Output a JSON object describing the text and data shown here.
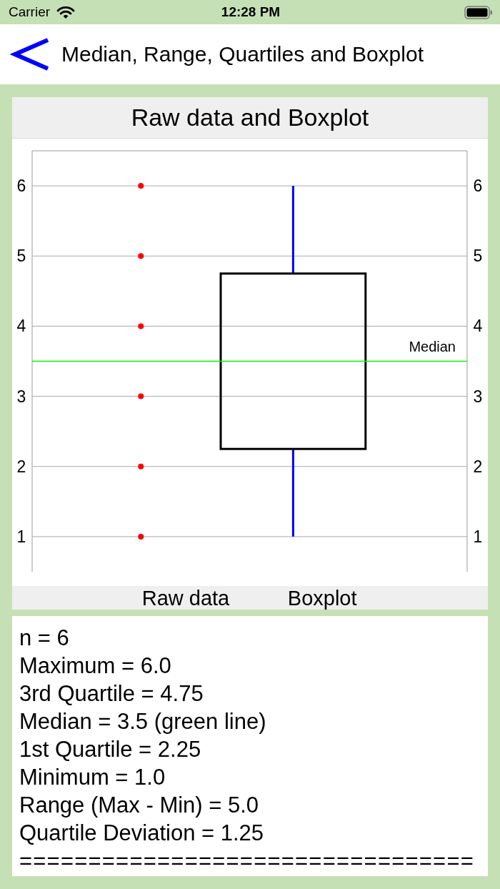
{
  "status_bar": {
    "carrier": "Carrier",
    "time": "12:28 PM"
  },
  "nav_bar": {
    "title": "Median, Range, Quartiles and Boxplot"
  },
  "chart_panel": {
    "chart_data": {
      "type": "scatter",
      "title": "Raw data and Boxplot",
      "categories": [
        "Raw data",
        "Boxplot"
      ],
      "series": [
        {
          "color": "#ff0000",
          "values": [
            1,
            null
          ]
        },
        {
          "color": "#ff0000",
          "values": [
            2,
            null
          ]
        },
        {
          "color": "#ff0000",
          "values": [
            3,
            null
          ]
        },
        {
          "color": "#ff0000",
          "values": [
            4,
            null
          ]
        },
        {
          "color": "#ff0000",
          "values": [
            5,
            null
          ]
        },
        {
          "color": "#ff0000",
          "values": [
            6,
            null
          ]
        }
      ],
      "ylim": [
        0.5,
        6.5
      ],
      "yticks": [
        1,
        2,
        3,
        4,
        5,
        6
      ],
      "grid": true,
      "ref_lines": [
        {
          "axis": "y",
          "value": 3.5,
          "label": "Median",
          "color": "#00ff00"
        }
      ]
    },
    "left_axis_labels": [
      "6",
      "5",
      "4",
      "3",
      "2",
      "1"
    ],
    "right_axis_labels": [
      "6",
      "5",
      "4",
      "3",
      "2",
      "1"
    ]
  },
  "results": {
    "lines": [
      "n = 6",
      "Maximum = 6.0",
      "3rd Quartile = 4.75",
      "Median = 3.5 (green line)",
      "1st Quartile = 2.25",
      "Minimum = 1.0",
      "Range (Max - Min) = 5.0",
      "Quartile Deviation = 1.25"
    ],
    "separator": "================================="
  }
}
